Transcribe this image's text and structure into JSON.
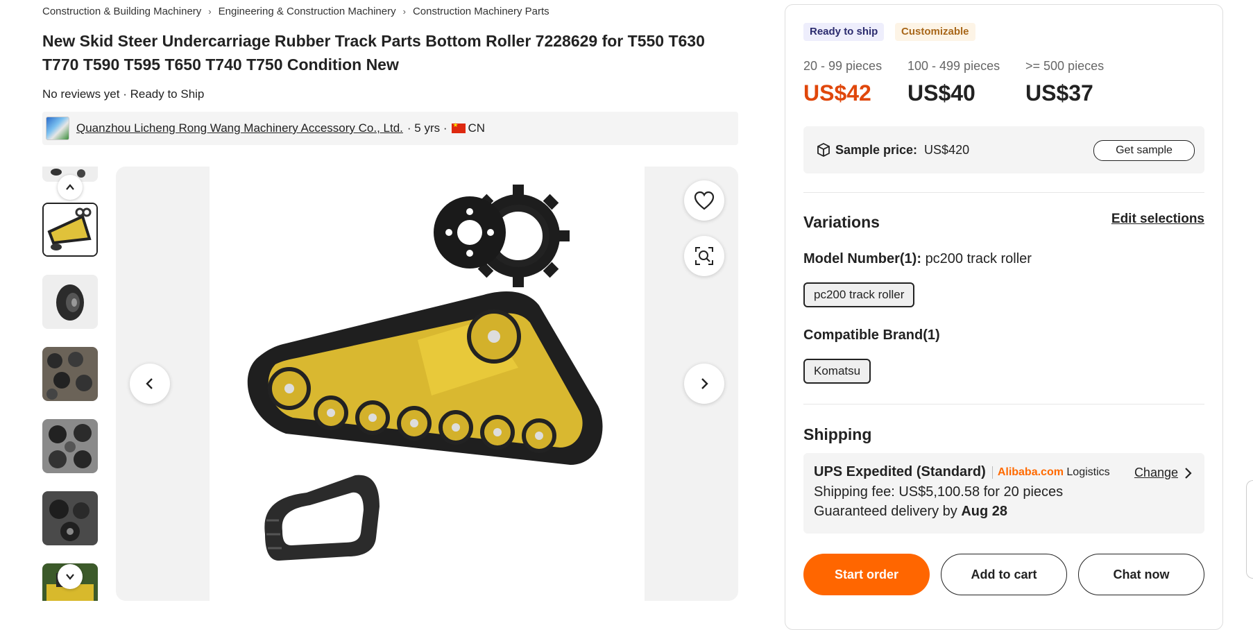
{
  "breadcrumb": [
    "Construction & Building Machinery",
    "Engineering & Construction Machinery",
    "Construction Machinery Parts"
  ],
  "product": {
    "title": "New Skid Steer Undercarriage Rubber Track Parts Bottom Roller 7228629 for T550 T630 T770 T590 T595 T650 T740 T750 Condition New",
    "meta": "No reviews yet · Ready to Ship"
  },
  "supplier": {
    "name": "Quanzhou Licheng Rong Wang Machinery Accessory Co., Ltd.",
    "years": " · 5 yrs · ",
    "country": "CN"
  },
  "gallery": {
    "thumbnail_count": 7,
    "selected_index": 1
  },
  "tags": {
    "ready": "Ready to ship",
    "custom": "Customizable"
  },
  "pricing": [
    {
      "range": "20 - 99 pieces",
      "price": "US$42"
    },
    {
      "range": "100 - 499 pieces",
      "price": "US$40"
    },
    {
      "range": ">= 500 pieces",
      "price": "US$37"
    }
  ],
  "sample": {
    "label": "Sample price:",
    "price": "US$420",
    "button": "Get sample"
  },
  "variations": {
    "title": "Variations",
    "edit": "Edit selections",
    "model_label": "Model Number(1):",
    "model_value": "pc200 track roller",
    "model_chip": "pc200 track roller",
    "brand_label": "Compatible Brand(1)",
    "brand_chip": "Komatsu"
  },
  "shipping": {
    "title": "Shipping",
    "method": "UPS Expedited (Standard)",
    "provider_brand": "Alibaba.com",
    "provider_suffix": " Logistics",
    "change": "Change",
    "fee": "Shipping fee: US$5,100.58 for 20 pieces",
    "delivery_prefix": "Guaranteed delivery by ",
    "delivery_date": "Aug 28"
  },
  "actions": {
    "start_order": "Start order",
    "add_to_cart": "Add to cart",
    "chat_now": "Chat now"
  },
  "colors": {
    "accent": "#ff6600",
    "price_active": "#e0470b",
    "ready_tag_bg": "#eeeefc",
    "custom_tag_text": "#a8671a"
  }
}
